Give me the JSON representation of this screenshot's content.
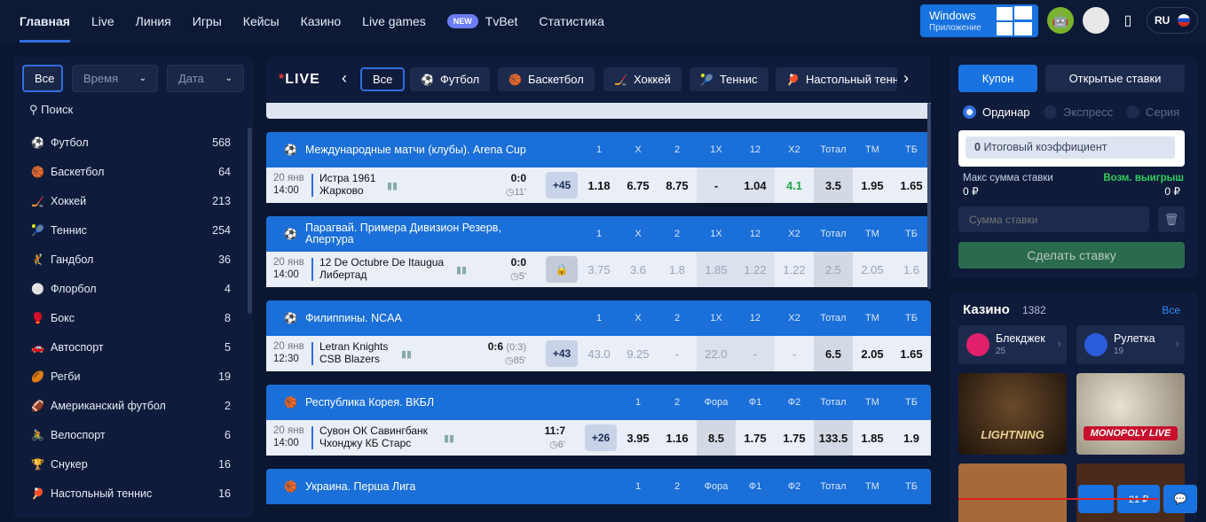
{
  "nav": {
    "items": [
      "Главная",
      "Live",
      "Линия",
      "Игры",
      "Кейсы",
      "Казино",
      "Live games"
    ],
    "new_badge": "NEW",
    "tvbet": "TvBet",
    "stats": "Статистика"
  },
  "windows": {
    "title": "Windows",
    "subtitle": "Приложение"
  },
  "lang": "RU",
  "filters": {
    "all": "Все",
    "time": "Время",
    "date": "Дата",
    "search": "Поиск"
  },
  "sports": [
    {
      "icon": "⚽",
      "name": "Футбол",
      "count": "568"
    },
    {
      "icon": "🏀",
      "name": "Баскетбол",
      "count": "64"
    },
    {
      "icon": "🏒",
      "name": "Хоккей",
      "count": "213"
    },
    {
      "icon": "🎾",
      "name": "Теннис",
      "count": "254"
    },
    {
      "icon": "🤾",
      "name": "Гандбол",
      "count": "36"
    },
    {
      "icon": "⚪",
      "name": "Флорбол",
      "count": "4"
    },
    {
      "icon": "🥊",
      "name": "Бокс",
      "count": "8"
    },
    {
      "icon": "🚗",
      "name": "Автоспорт",
      "count": "5"
    },
    {
      "icon": "🏉",
      "name": "Регби",
      "count": "19"
    },
    {
      "icon": "🏈",
      "name": "Американский футбол",
      "count": "2"
    },
    {
      "icon": "🚴",
      "name": "Велоспорт",
      "count": "6"
    },
    {
      "icon": "🏆",
      "name": "Снукер",
      "count": "16"
    },
    {
      "icon": "🏓",
      "name": "Настольный теннис",
      "count": "16"
    }
  ],
  "live": {
    "label": "LIVE",
    "star": "*",
    "chips": [
      "Все",
      "Футбол",
      "Баскетбол",
      "Хоккей",
      "Теннис",
      "Настольный тенн"
    ]
  },
  "events": [
    {
      "league": "Международные матчи (клубы). Arena Cup",
      "cols": [
        "1",
        "X",
        "2",
        "1X",
        "12",
        "X2",
        "Тотал",
        "ТМ",
        "ТБ"
      ],
      "date": "20 янв",
      "time": "14:00",
      "team1": "Истра 1961",
      "team2": "Жарково",
      "score": "0:0",
      "extra": "",
      "minute": "11'",
      "plus": "+45",
      "odds": [
        "1.18",
        "6.75",
        "8.75",
        "-",
        "1.04",
        "4.1",
        "3.5",
        "1.95",
        "1.65"
      ]
    },
    {
      "league": "Парагвай. Примера Дивизион Резерв, Апертура",
      "cols": [
        "1",
        "X",
        "2",
        "1X",
        "12",
        "X2",
        "Тотал",
        "ТМ",
        "ТБ"
      ],
      "date": "20 янв",
      "time": "14:00",
      "team1": "12 De Octubre De Itaugua",
      "team2": "Либертад",
      "score": "0:0",
      "extra": "",
      "minute": "5'",
      "plus": "",
      "odds": [
        "3.75",
        "3.6",
        "1.8",
        "1.85",
        "1.22",
        "1.22",
        "2.5",
        "2.05",
        "1.6"
      ]
    },
    {
      "league": "Филиппины. NCAA",
      "cols": [
        "1",
        "X",
        "2",
        "1X",
        "12",
        "X2",
        "Тотал",
        "ТМ",
        "ТБ"
      ],
      "date": "20 янв",
      "time": "12:30",
      "team1": "Letran Knights",
      "team2": "CSB Blazers",
      "score": "0:6",
      "extra": "(0:3)",
      "minute": "85'",
      "plus": "+43",
      "odds": [
        "43.0",
        "9.25",
        "-",
        "22.0",
        "-",
        "-",
        "6.5",
        "2.05",
        "1.65"
      ]
    },
    {
      "league": "Республика Корея. ВКБЛ",
      "cols": [
        "1",
        "2",
        "Фора",
        "Ф1",
        "Ф2",
        "Тотал",
        "ТМ",
        "ТБ"
      ],
      "date": "20 янв",
      "time": "14:00",
      "team1": "Сувон ОК Савингбанк",
      "team2": "Чхонджу КБ Старс",
      "score": "11:7",
      "extra": "",
      "minute": "6'",
      "plus": "+26",
      "odds": [
        "3.95",
        "1.16",
        "8.5",
        "1.75",
        "1.75",
        "133.5",
        "1.85",
        "1.9"
      ]
    },
    {
      "league": "Украина. Перша Лига",
      "cols": [
        "1",
        "2",
        "Фора",
        "Ф1",
        "Ф2",
        "Тотал",
        "ТМ",
        "ТБ"
      ]
    }
  ],
  "coupon": {
    "tab1": "Купон",
    "tab2": "Открытые ставки",
    "r1": "Ординар",
    "r2": "Экспресс",
    "r3": "Серия",
    "coef_val": "0",
    "coef_lbl": "Итоговый коэффициент",
    "max_lbl": "Макс сумма ставки",
    "max_val": "0 ₽",
    "win_lbl": "Возм. выигрыш",
    "win_val": "0 ₽",
    "stake_ph": "Сумма ставки",
    "bet_btn": "Сделать ставку"
  },
  "casino": {
    "title": "Казино",
    "count": "1382",
    "all": "Все",
    "cats": [
      {
        "name": "Блекджек",
        "count": "25"
      },
      {
        "name": "Рулетка",
        "count": "19"
      }
    ],
    "tiles": [
      "LIGHTNING",
      "MONOPOLY LIVE"
    ],
    "bottom_val": "21 ₽"
  }
}
